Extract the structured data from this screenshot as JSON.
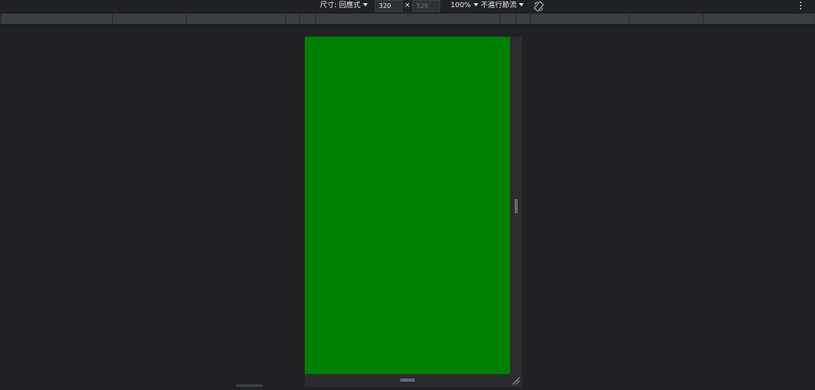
{
  "toolbar": {
    "dimensions_label": "尺寸: 回應式",
    "width_value": "320",
    "height_placeholder": "526",
    "times": "×",
    "zoom_label": "100%",
    "throttle_label": "不進行節流"
  },
  "viewport": {
    "background_color": "#008000"
  },
  "icons": {
    "rotate": "rotate-icon",
    "more": "more-vert-icon",
    "dropdown": "caret-down-icon"
  }
}
